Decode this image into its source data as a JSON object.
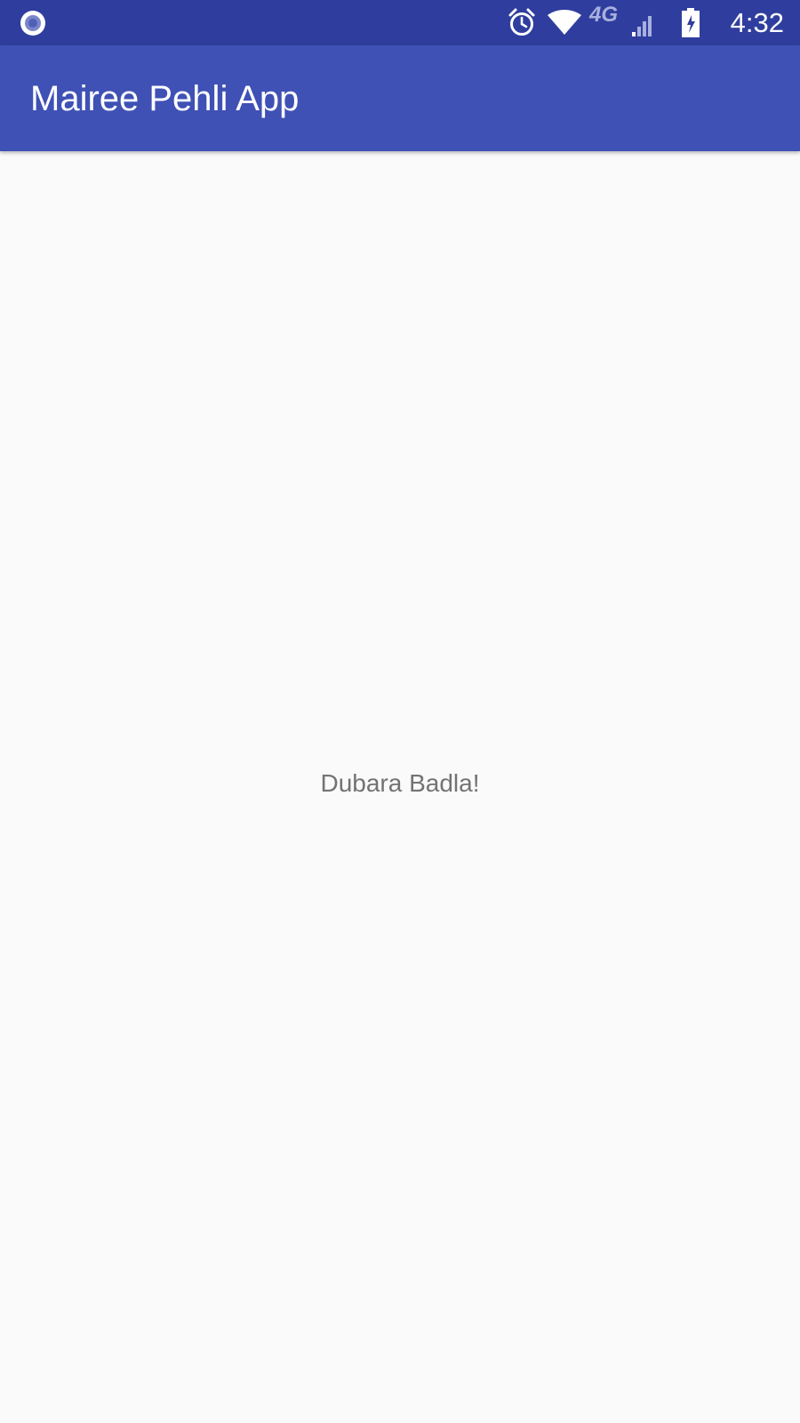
{
  "status_bar": {
    "time": "4:32",
    "network_label": "4G",
    "icons": [
      "notification-circle-icon",
      "alarm-icon",
      "wifi-icon",
      "cellular-signal-icon",
      "battery-charging-icon"
    ]
  },
  "app_bar": {
    "title": "Mairee Pehli App"
  },
  "main": {
    "message": "Dubara Badla!"
  },
  "colors": {
    "status_bar": "#2f3e9e",
    "app_bar": "#3f51b5",
    "background": "#fafafa",
    "message_text": "#737373"
  }
}
